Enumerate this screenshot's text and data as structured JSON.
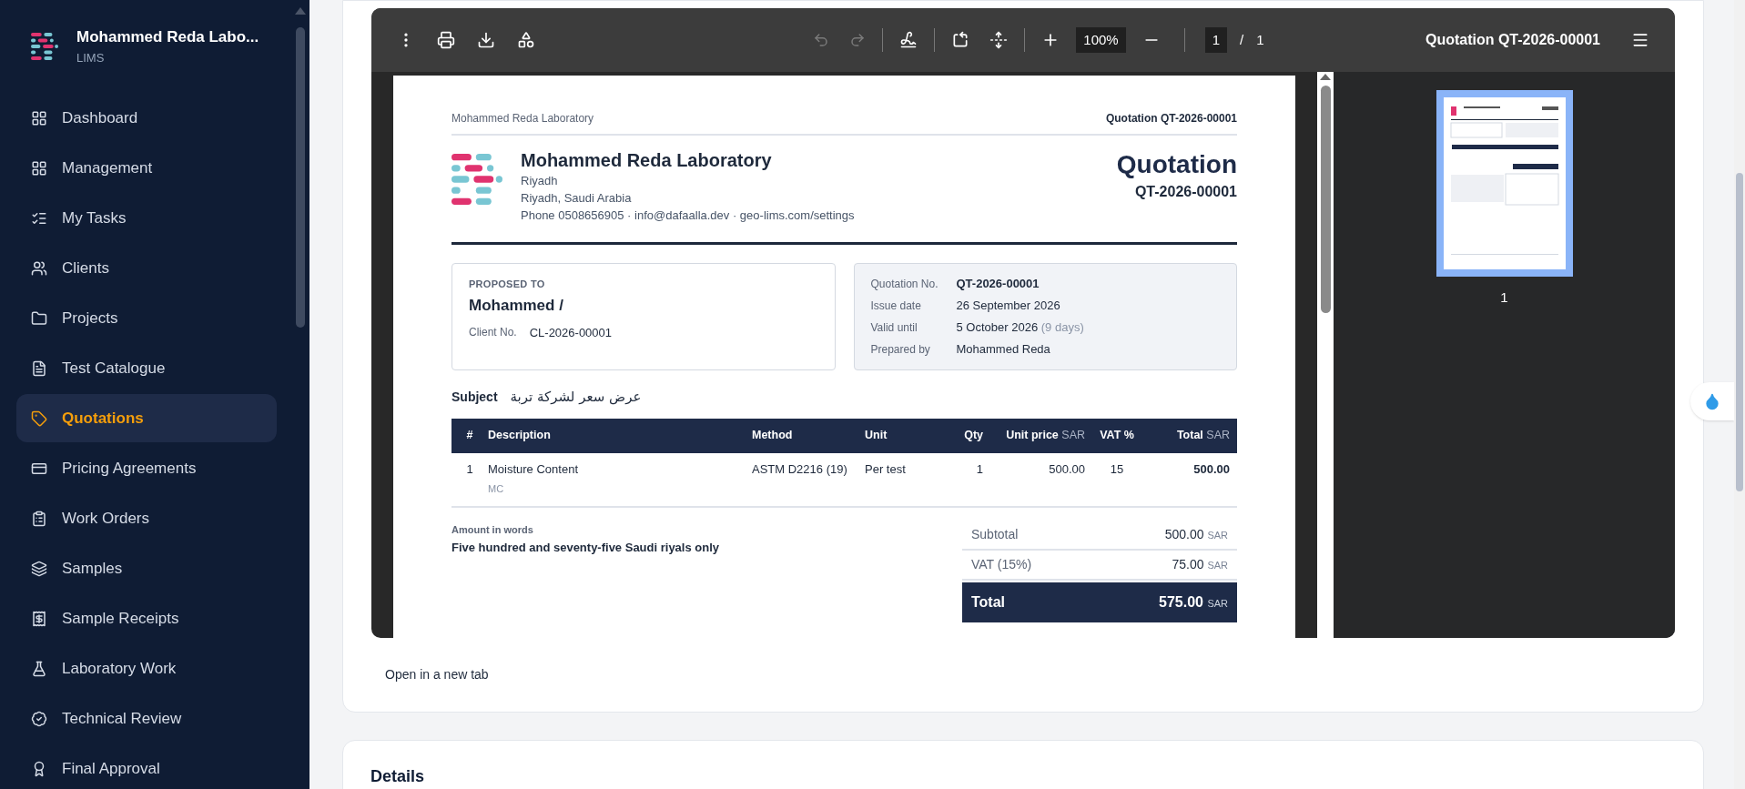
{
  "sidebar": {
    "org_name": "Mohammed Reda Labo...",
    "subtitle": "LIMS",
    "items": [
      {
        "label": "Dashboard",
        "selected": false
      },
      {
        "label": "Management",
        "selected": false
      },
      {
        "label": "My Tasks",
        "selected": false
      },
      {
        "label": "Clients",
        "selected": false
      },
      {
        "label": "Projects",
        "selected": false
      },
      {
        "label": "Test Catalogue",
        "selected": false
      },
      {
        "label": "Quotations",
        "selected": true
      },
      {
        "label": "Pricing Agreements",
        "selected": false
      },
      {
        "label": "Work Orders",
        "selected": false
      },
      {
        "label": "Samples",
        "selected": false
      },
      {
        "label": "Sample Receipts",
        "selected": false
      },
      {
        "label": "Laboratory Work",
        "selected": false
      },
      {
        "label": "Technical Review",
        "selected": false
      },
      {
        "label": "Final Approval",
        "selected": false
      }
    ]
  },
  "viewer": {
    "toolbar": {
      "undo": {
        "disabled": true
      },
      "redo": {
        "disabled": true
      },
      "zoom": "100%",
      "page": "1",
      "page_separator": "/",
      "page_count": "1",
      "title": "Quotation QT-2026-00001"
    },
    "document": {
      "running_left": "Mohammed Reda Laboratory",
      "running_right": "Quotation QT-2026-00001",
      "company_name": "Mohammed Reda Laboratory",
      "address": [
        "Riyadh",
        "Riyadh, Saudi Arabia"
      ],
      "contact": "Phone 0508656905 · info@dafaalla.dev · geo-lims.com/settings",
      "doc_title": "Quotation",
      "doc_number": "QT-2026-00001",
      "proposed_to": {
        "label": "PROPOSED TO",
        "name": "Mohammed /",
        "client_no_label": "Client No.",
        "client_no": "CL-2026-00001"
      },
      "meta": [
        {
          "label": "Quotation No.",
          "value": "QT-2026-00001",
          "kind": "strong"
        },
        {
          "label": "Issue date",
          "value": "26 September 2026",
          "kind": "plain"
        },
        {
          "label": "Valid until",
          "value": "5 October 2026",
          "note": "(9 days)",
          "kind": "plain"
        },
        {
          "label": "Prepared by",
          "value": "Mohammed Reda",
          "kind": "plain"
        }
      ],
      "subject": {
        "label": "Subject",
        "value": "عرض سعر لشركة تربة"
      },
      "columns": [
        {
          "label": "#"
        },
        {
          "label": "Description"
        },
        {
          "label": "Method"
        },
        {
          "label": "Unit"
        },
        {
          "label": "Qty"
        },
        {
          "label": "Unit price",
          "unit": "SAR"
        },
        {
          "label": "VAT %"
        },
        {
          "label": "Total",
          "unit": "SAR"
        }
      ],
      "rows": [
        {
          "index": "1",
          "description": "Moisture Content",
          "code": "MC",
          "method": "ASTM D2216 (19)",
          "unit": "Per test",
          "qty": "1",
          "unit_price": "500.00",
          "vat": "15",
          "total": "500.00"
        }
      ],
      "amount_in_words": {
        "label": "Amount in words",
        "value": "Five hundred and seventy-five Saudi riyals only"
      },
      "totals": [
        {
          "label": "Subtotal",
          "value": "500.00",
          "currency": "SAR",
          "kind": "line"
        },
        {
          "label": "VAT (15%)",
          "value": "75.00",
          "currency": "SAR",
          "kind": "line"
        },
        {
          "label": "Total",
          "value": "575.00",
          "currency": "SAR",
          "kind": "grand"
        }
      ]
    },
    "thumbnail": {
      "label": "1",
      "selected": true
    }
  },
  "open_link": "Open in a new tab",
  "details_heading": "Details"
}
